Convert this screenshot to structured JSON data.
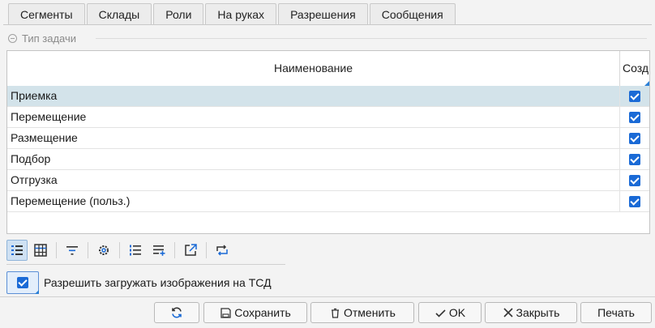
{
  "tabs": [
    "Сегменты",
    "Склады",
    "Роли",
    "На руках",
    "Разрешения",
    "Сообщения"
  ],
  "group": {
    "label": "Тип задачи"
  },
  "table": {
    "columns": {
      "name": "Наименование",
      "create": "Созд"
    },
    "rows": [
      {
        "name": "Приемка",
        "create": true,
        "selected": true
      },
      {
        "name": "Перемещение",
        "create": true
      },
      {
        "name": "Размещение",
        "create": true
      },
      {
        "name": "Подбор",
        "create": true
      },
      {
        "name": "Отгрузка",
        "create": true
      },
      {
        "name": "Перемещение (польз.)",
        "create": true
      }
    ]
  },
  "toolbar": {
    "icons": [
      "list-view-icon",
      "grid-view-icon",
      "filter-icon",
      "settings-icon",
      "numbered-list-icon",
      "add-list-icon",
      "export-icon",
      "transfer-icon"
    ]
  },
  "upload": {
    "label": "Разрешить загружать изображения на ТСД",
    "checked": true
  },
  "buttons": {
    "save": "Сохранить",
    "cancel": "Отменить",
    "ok": "OK",
    "close": "Закрыть",
    "print": "Печать"
  },
  "colors": {
    "accent": "#1a6ad6",
    "selected_row": "#d3e3ea"
  }
}
